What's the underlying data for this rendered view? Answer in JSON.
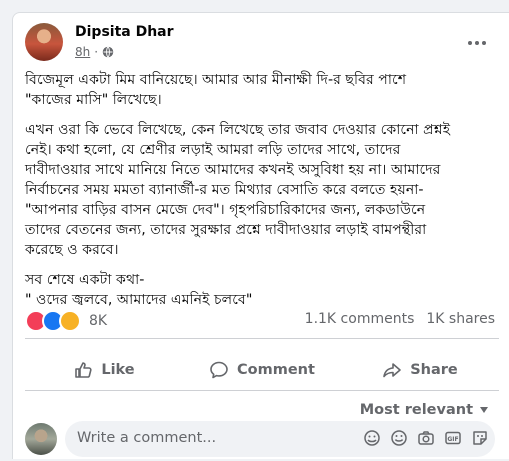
{
  "post": {
    "author": "Dipsita Dhar",
    "time": "8h",
    "privacy_icon": "globe-icon",
    "paragraphs": [
      "বিজেমূল একটা মিম বানিয়েছে। আমার আর মীনাক্ষী দি-র ছবির পাশে\n\"কাজের মাসি\" লিখেছে।",
      "এখন ওরা কি ভেবে লিখেছে, কেন লিখেছে তার জবাব দেওয়ার কোনো প্রশ্নই\nনেই। কথা হলো, যে শ্রেণীর লড়াই আমরা লড়ি তাদের সাথে, তাদের\nদাবীদাওয়ার সাথে মানিয়ে নিতে আমাদের কখনই অসুবিধা হয় না। আমাদের\nনির্বাচনের সময় মমতা ব্যানার্জী-র মত মিথ্যার বেসাতি করে বলতে হয়না-\n\"আপনার বাড়ির বাসন মেজে দেব\"। গৃহপরিচারিকাদের জন্য, লকডাউনে\nতাদের বেতনের জন্য, তাদের সুরক্ষার প্রশ্নে দাবীদাওয়ার লড়াই বামপন্থীরা\nকরেছে ও করবে।",
      "সব শেষে একটা কথা-\n\" ওদের জ্বলবে, আমাদের এমনিই চলবে\""
    ]
  },
  "stats": {
    "reaction_count": "8K",
    "comments": "1.1K comments",
    "shares": "1K shares",
    "reactions": [
      "love",
      "like",
      "care"
    ]
  },
  "actions": {
    "like": "Like",
    "comment": "Comment",
    "share": "Share"
  },
  "sort": {
    "label": "Most relevant"
  },
  "composer": {
    "placeholder": "Write a comment..."
  },
  "colors": {
    "accent": "#1877f2",
    "love": "#f33e58",
    "care": "#f7b125",
    "muted_text": "#65676b"
  }
}
